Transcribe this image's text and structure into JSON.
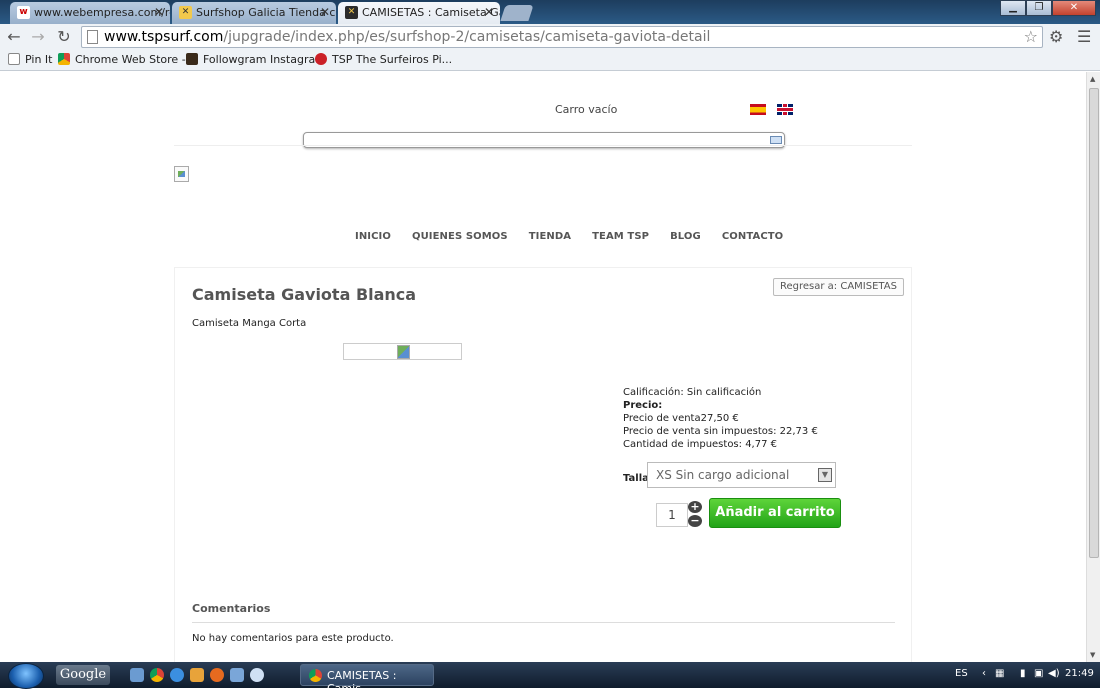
{
  "browser": {
    "tabs": [
      {
        "title": "www.webempresa.com/re",
        "favicon": "webempresa-icon",
        "active": false
      },
      {
        "title": "Surfshop Galicia Tienda c",
        "favicon": "surfshop-icon",
        "active": false
      },
      {
        "title": "CAMISETAS : Camiseta Ga",
        "favicon": "tsp-icon",
        "active": true
      }
    ],
    "url_host": "www.tspsurf.com",
    "url_path": "/jupgrade/index.php/es/surfshop-2/camisetas/camiseta-gaviota-detail",
    "bookmarks": [
      {
        "label": "Pin It",
        "icon": "page-icon"
      },
      {
        "label": "Chrome Web Store -...",
        "icon": "chrome-store-icon"
      },
      {
        "label": "Followgram Instagra...",
        "icon": "followgram-icon"
      },
      {
        "label": "TSP The Surfeiros Pi...",
        "icon": "pinterest-icon"
      }
    ]
  },
  "page": {
    "cart_text": "Carro vacío",
    "nav": [
      "INICIO",
      "QUIENES SOMOS",
      "TIENDA",
      "TEAM TSP",
      "BLOG",
      "CONTACTO"
    ],
    "back_button": "Regresar a: CAMISETAS",
    "product": {
      "title": "Camiseta Gaviota Blanca",
      "subtitle": "Camiseta Manga Corta",
      "rating_line": "Calificación: Sin calificación",
      "price_label": "Precio:",
      "sale_price": "Precio de venta27,50 €",
      "price_no_tax": "Precio de venta sin impuestos: 22,73 €",
      "tax_amount": "Cantidad de impuestos: 4,77 €",
      "size_label": "Talla",
      "size_selected": "XS Sin cargo adicional",
      "quantity": "1",
      "add_to_cart": "Añadir al carrito"
    },
    "comments": {
      "title": "Comentarios",
      "empty": "No hay comentarios para este producto."
    }
  },
  "taskbar": {
    "search_brand": "Google",
    "task_label": "CAMISETAS : Camis...",
    "lang": "ES",
    "time": "21:49"
  },
  "colors": {
    "add_button": "#2fb822",
    "titlebar": "#2b5a86"
  }
}
